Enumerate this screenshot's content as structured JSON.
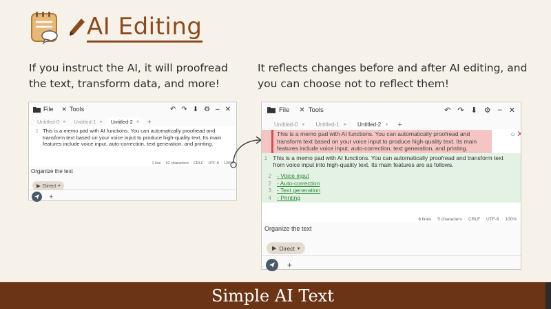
{
  "header": {
    "title": "AI Editing",
    "caption_left": "If you instruct the AI, it will proofread the text, transform data, and more!",
    "caption_right": "It reflects changes before and after AI editing, and you can choose not to reflect them!"
  },
  "menu": {
    "file": "File",
    "tools": "Tools"
  },
  "tabs": [
    "Untitled-0",
    "Untitled-1",
    "Untitled-2"
  ],
  "window_before": {
    "line_number": "1",
    "text": "This is a memo pad with AI functions. You can automatically proofread and transform text based on your voice input to produce high-quality text. Its main features include voice input, auto-correction, text generation, and printing.",
    "status": [
      "1 line",
      "92 characters",
      "CRLF",
      "UTF-8",
      "100%"
    ],
    "prompt": "Organize the text",
    "direct": "Direct"
  },
  "window_after": {
    "old_text": "This is a memo pad with AI functions. You can automatically proofread and transform text based on your voice input to produce high-quality text. Its main features include voice input, auto-correction, text generation, and printing.",
    "new_line_number": "1",
    "new_text": "This is a memo pad with AI functions. You can automatically proofread and transform text from voice input into high-quality text. Its main features are as follows.",
    "items": [
      {
        "ln": "2",
        "text": "- Voice input"
      },
      {
        "ln": "2",
        "text": "- Auto-correction"
      },
      {
        "ln": "3",
        "text": "- Text generation"
      },
      {
        "ln": "4",
        "text": "- Printing"
      }
    ],
    "status": [
      "6 lines",
      "5 characters",
      "CRLF",
      "UTF-8",
      "100%"
    ],
    "prompt": "Organize the text",
    "direct": "Direct"
  },
  "footer": {
    "text": "Simple AI Text"
  },
  "colors": {
    "accent": "#8a4a1e",
    "footer_bg": "#6b3416",
    "deleted_bg": "#f5c5c3",
    "added_bg": "#e4f2e4"
  }
}
